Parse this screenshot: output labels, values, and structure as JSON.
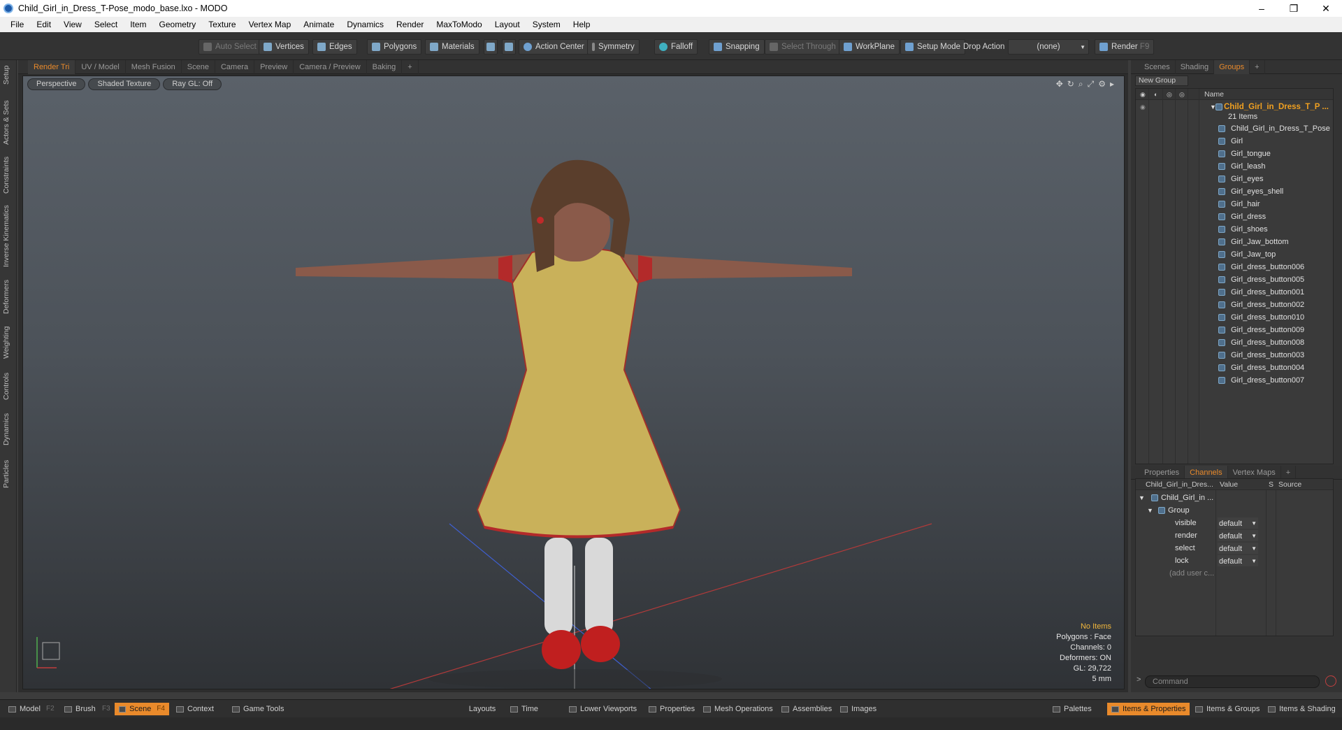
{
  "window": {
    "title": "Child_Girl_in_Dress_T-Pose_modo_base.lxo - MODO",
    "controls": [
      "–",
      "❐",
      "✕"
    ]
  },
  "menu": [
    "File",
    "Edit",
    "View",
    "Select",
    "Item",
    "Geometry",
    "Texture",
    "Vertex Map",
    "Animate",
    "Dynamics",
    "Render",
    "MaxToModo",
    "Layout",
    "System",
    "Help"
  ],
  "toolbar": {
    "auto_select": "Auto Select",
    "vertices": "Vertices",
    "edges": "Edges",
    "polygons": "Polygons",
    "materials": "Materials",
    "action_center": "Action Center",
    "symmetry": "Symmetry",
    "falloff": "Falloff",
    "snapping": "Snapping",
    "select_through": "Select Through",
    "workplane": "WorkPlane",
    "setup_mode": "Setup Mode",
    "drop_action": "Drop Action",
    "drop_value": "(none)",
    "render": "Render",
    "render_key": "F9"
  },
  "left_tabs": [
    "Setup",
    "Actors & Sets",
    "Constraints",
    "Inverse Kinematics",
    "Deformers",
    "Weighting",
    "Controls",
    "Dynamics",
    "Particles"
  ],
  "viewport_tabs": [
    "Render Tri",
    "UV / Model",
    "Mesh Fusion",
    "Scene",
    "Camera",
    "Preview",
    "Camera / Preview",
    "Baking",
    "+"
  ],
  "viewport": {
    "perspective": "Perspective",
    "shading": "Shaded Texture",
    "raygl": "Ray GL: Off",
    "stats": {
      "no_items": "No Items",
      "polygons": "Polygons : Face",
      "channels": "Channels: 0",
      "deformers": "Deformers: ON",
      "gl": "GL: 29,722",
      "scale": "5 mm"
    }
  },
  "right_tabs": [
    "Scenes",
    "Shading",
    "Groups",
    "+"
  ],
  "groups": {
    "new_group": "New Group",
    "name_header": "Name",
    "root": "Child_Girl_in_Dress_T_P ...",
    "count": "21 Items",
    "items": [
      "Child_Girl_in_Dress_T_Pose",
      "Girl",
      "Girl_tongue",
      "Girl_leash",
      "Girl_eyes",
      "Girl_eyes_shell",
      "Girl_hair",
      "Girl_dress",
      "Girl_shoes",
      "Girl_Jaw_bottom",
      "Girl_Jaw_top",
      "Girl_dress_button006",
      "Girl_dress_button005",
      "Girl_dress_button001",
      "Girl_dress_button002",
      "Girl_dress_button010",
      "Girl_dress_button009",
      "Girl_dress_button008",
      "Girl_dress_button003",
      "Girl_dress_button004",
      "Girl_dress_button007"
    ]
  },
  "props_tabs": [
    "Properties",
    "Channels",
    "Vertex Maps",
    "+"
  ],
  "channels": {
    "headers": {
      "name": "Child_Girl_in_Dres...",
      "value": "Value",
      "s": "S",
      "source": "Source"
    },
    "root": "Child_Girl_in ...",
    "group": "Group",
    "rows": [
      {
        "name": "visible",
        "value": "default"
      },
      {
        "name": "render",
        "value": "default"
      },
      {
        "name": "select",
        "value": "default"
      },
      {
        "name": "lock",
        "value": "default"
      }
    ],
    "add": "(add user c..."
  },
  "command": {
    "placeholder": "Command"
  },
  "bottom": {
    "model": "Model",
    "f2": "F2",
    "brush": "Brush",
    "f3": "F3",
    "scene": "Scene",
    "f4": "F4",
    "context": "Context",
    "game_tools": "Game Tools",
    "layouts": "Layouts",
    "time": "Time",
    "lower_viewports": "Lower Viewports",
    "properties": "Properties",
    "mesh_operations": "Mesh Operations",
    "assemblies": "Assemblies",
    "images": "Images",
    "palettes": "Palettes",
    "items_properties": "Items & Properties",
    "items_groups": "Items & Groups",
    "items_shading": "Items & Shading"
  },
  "colors": {
    "accent": "#e98a2b",
    "group_root": "#f0a020"
  }
}
